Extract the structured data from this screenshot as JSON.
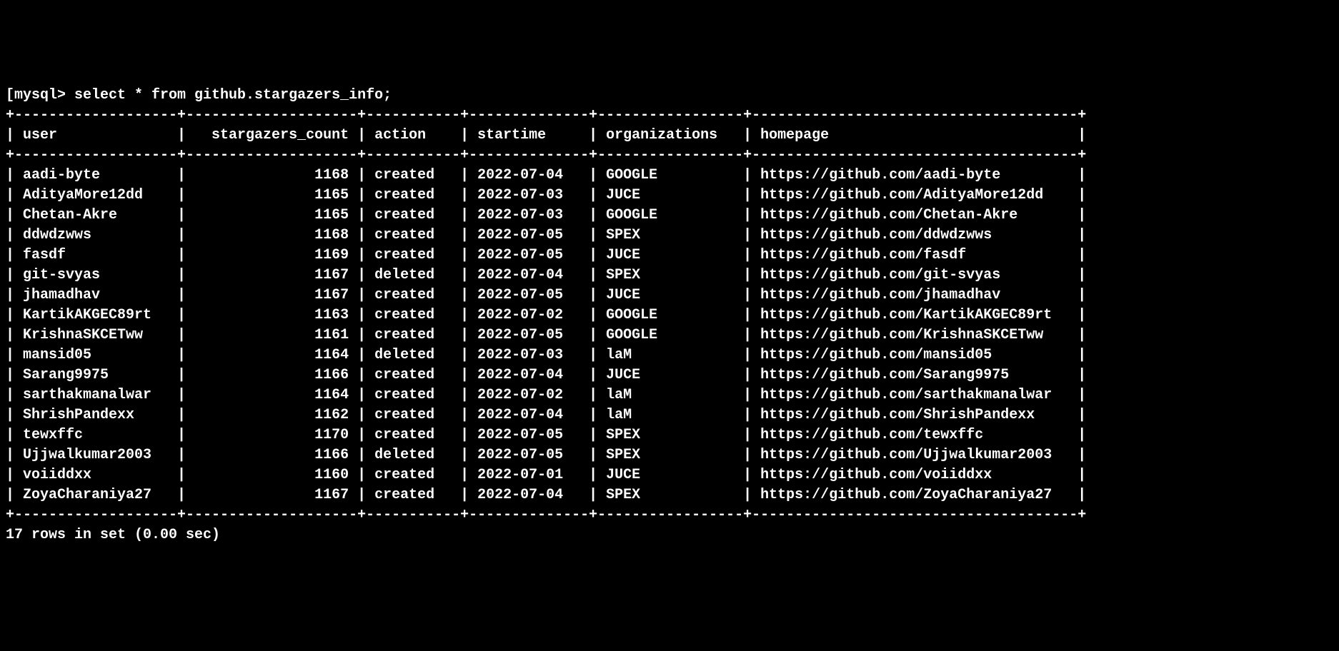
{
  "prompt": "[mysql> ",
  "query": "select * from github.stargazers_info;",
  "columns": [
    "user",
    "stargazers_count",
    "action",
    "startime",
    "organizations",
    "homepage"
  ],
  "widths": [
    17,
    18,
    9,
    12,
    15,
    36
  ],
  "alignments": [
    "left",
    "right",
    "left",
    "left",
    "left",
    "left"
  ],
  "rows": [
    {
      "user": "aadi-byte",
      "stargazers_count": "1168",
      "action": "created",
      "startime": "2022-07-04",
      "organizations": "GOOGLE",
      "homepage": "https://github.com/aadi-byte"
    },
    {
      "user": "AdityaMore12dd",
      "stargazers_count": "1165",
      "action": "created",
      "startime": "2022-07-03",
      "organizations": "JUCE",
      "homepage": "https://github.com/AdityaMore12dd"
    },
    {
      "user": "Chetan-Akre",
      "stargazers_count": "1165",
      "action": "created",
      "startime": "2022-07-03",
      "organizations": "GOOGLE",
      "homepage": "https://github.com/Chetan-Akre"
    },
    {
      "user": "ddwdzwws",
      "stargazers_count": "1168",
      "action": "created",
      "startime": "2022-07-05",
      "organizations": "SPEX",
      "homepage": "https://github.com/ddwdzwws"
    },
    {
      "user": "fasdf",
      "stargazers_count": "1169",
      "action": "created",
      "startime": "2022-07-05",
      "organizations": "JUCE",
      "homepage": "https://github.com/fasdf"
    },
    {
      "user": "git-svyas",
      "stargazers_count": "1167",
      "action": "deleted",
      "startime": "2022-07-04",
      "organizations": "SPEX",
      "homepage": "https://github.com/git-svyas"
    },
    {
      "user": "jhamadhav",
      "stargazers_count": "1167",
      "action": "created",
      "startime": "2022-07-05",
      "organizations": "JUCE",
      "homepage": "https://github.com/jhamadhav"
    },
    {
      "user": "KartikAKGEC89rt",
      "stargazers_count": "1163",
      "action": "created",
      "startime": "2022-07-02",
      "organizations": "GOOGLE",
      "homepage": "https://github.com/KartikAKGEC89rt"
    },
    {
      "user": "KrishnaSKCETww",
      "stargazers_count": "1161",
      "action": "created",
      "startime": "2022-07-05",
      "organizations": "GOOGLE",
      "homepage": "https://github.com/KrishnaSKCETww"
    },
    {
      "user": "mansid05",
      "stargazers_count": "1164",
      "action": "deleted",
      "startime": "2022-07-03",
      "organizations": "laM",
      "homepage": "https://github.com/mansid05"
    },
    {
      "user": "Sarang9975",
      "stargazers_count": "1166",
      "action": "created",
      "startime": "2022-07-04",
      "organizations": "JUCE",
      "homepage": "https://github.com/Sarang9975"
    },
    {
      "user": "sarthakmanalwar",
      "stargazers_count": "1164",
      "action": "created",
      "startime": "2022-07-02",
      "organizations": "laM",
      "homepage": "https://github.com/sarthakmanalwar"
    },
    {
      "user": "ShrishPandexx",
      "stargazers_count": "1162",
      "action": "created",
      "startime": "2022-07-04",
      "organizations": "laM",
      "homepage": "https://github.com/ShrishPandexx"
    },
    {
      "user": "tewxffc",
      "stargazers_count": "1170",
      "action": "created",
      "startime": "2022-07-05",
      "organizations": "SPEX",
      "homepage": "https://github.com/tewxffc"
    },
    {
      "user": "Ujjwalkumar2003",
      "stargazers_count": "1166",
      "action": "deleted",
      "startime": "2022-07-05",
      "organizations": "SPEX",
      "homepage": "https://github.com/Ujjwalkumar2003"
    },
    {
      "user": "voiiddxx",
      "stargazers_count": "1160",
      "action": "created",
      "startime": "2022-07-01",
      "organizations": "JUCE",
      "homepage": "https://github.com/voiiddxx"
    },
    {
      "user": "ZoyaCharaniya27",
      "stargazers_count": "1167",
      "action": "created",
      "startime": "2022-07-04",
      "organizations": "SPEX",
      "homepage": "https://github.com/ZoyaCharaniya27"
    }
  ],
  "footer": "17 rows in set (0.00 sec)"
}
